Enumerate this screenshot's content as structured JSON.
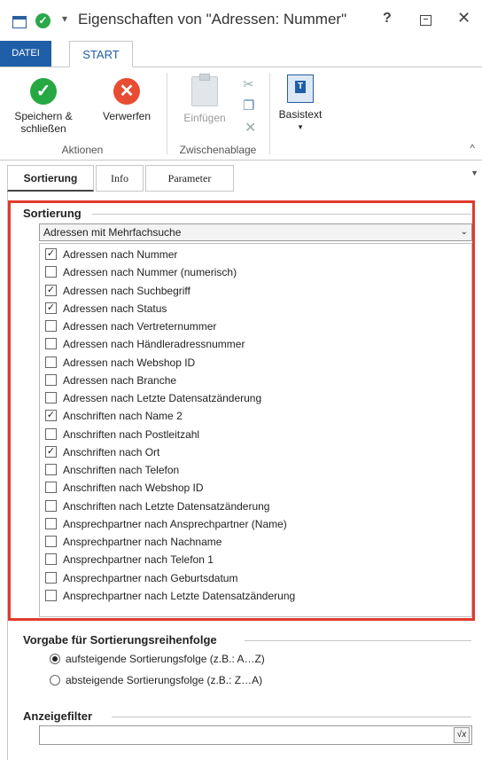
{
  "window": {
    "title": "Eigenschaften von \"Adressen: Nummer\"",
    "help_label": "?",
    "close_label": "✕",
    "qa_dropdown": "▾"
  },
  "ribbon_tabs": {
    "datei": "DATEI",
    "start": "START"
  },
  "ribbon": {
    "aktionen": {
      "save_label": "Speichern & schließen",
      "discard_label": "Verwerfen",
      "group_label": "Aktionen"
    },
    "zwischenablage": {
      "paste_label": "Einfügen",
      "group_label": "Zwischenablage"
    },
    "basistext": {
      "label": "Basistext",
      "arrow": "▾"
    },
    "collapse": "^"
  },
  "subtabs": {
    "sortierung": "Sortierung",
    "info": "Info",
    "parameter": "Parameter"
  },
  "sortierung": {
    "section_title": "Sortierung",
    "selected_option": "Adressen mit Mehrfachsuche",
    "items": [
      {
        "label": "Adressen nach Nummer",
        "checked": true
      },
      {
        "label": "Adressen nach Nummer (numerisch)",
        "checked": false
      },
      {
        "label": "Adressen nach Suchbegriff",
        "checked": true
      },
      {
        "label": "Adressen nach Status",
        "checked": true
      },
      {
        "label": "Adressen nach Vertreternummer",
        "checked": false
      },
      {
        "label": "Adressen nach Händleradressnummer",
        "checked": false
      },
      {
        "label": "Adressen nach Webshop ID",
        "checked": false
      },
      {
        "label": "Adressen nach Branche",
        "checked": false
      },
      {
        "label": "Adressen nach Letzte Datensatzänderung",
        "checked": false
      },
      {
        "label": "Anschriften nach Name 2",
        "checked": true
      },
      {
        "label": "Anschriften nach Postleitzahl",
        "checked": false
      },
      {
        "label": "Anschriften nach Ort",
        "checked": true
      },
      {
        "label": "Anschriften nach Telefon",
        "checked": false
      },
      {
        "label": "Anschriften nach Webshop ID",
        "checked": false
      },
      {
        "label": "Anschriften nach Letzte Datensatzänderung",
        "checked": false
      },
      {
        "label": "Ansprechpartner nach Ansprechpartner (Name)",
        "checked": false
      },
      {
        "label": "Ansprechpartner nach Nachname",
        "checked": false
      },
      {
        "label": "Ansprechpartner nach Telefon 1",
        "checked": false
      },
      {
        "label": "Ansprechpartner nach Geburtsdatum",
        "checked": false
      },
      {
        "label": "Ansprechpartner nach Letzte Datensatzänderung",
        "checked": false
      }
    ]
  },
  "vorgabe": {
    "section_title": "Vorgabe für Sortierungsreihenfolge",
    "options": [
      {
        "label": "aufsteigende Sortierungsfolge (z.B.: A…Z)",
        "selected": true
      },
      {
        "label": "absteigende Sortierungsfolge (z.B.: Z…A)",
        "selected": false
      }
    ]
  },
  "anzeigefilter": {
    "section_title": "Anzeigefilter",
    "value": "",
    "formula_icon": "√x"
  },
  "colors": {
    "accent_blue": "#1f5ea8",
    "highlight_red": "#e03a2c",
    "save_green": "#26a843",
    "discard_red": "#e84c32"
  }
}
